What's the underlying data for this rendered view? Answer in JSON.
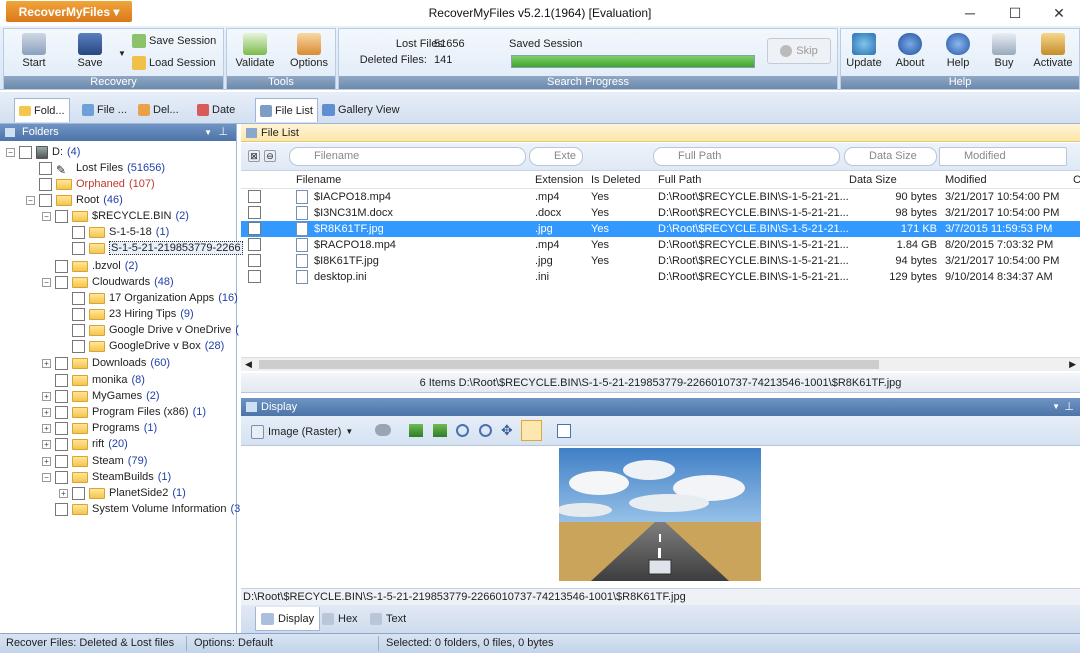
{
  "app": {
    "menu_button": "RecoverMyFiles",
    "title": "RecoverMyFiles v5.2.1(1964) [Evaluation]"
  },
  "ribbon": {
    "recovery": {
      "label": "Recovery",
      "start": "Start",
      "save": "Save",
      "save_session": "Save Session",
      "load_session": "Load Session"
    },
    "tools": {
      "label": "Tools",
      "validate": "Validate",
      "options": "Options"
    },
    "search_progress": {
      "label": "Search Progress",
      "lost_files_label": "Lost Files:",
      "lost_files_value": "51656",
      "deleted_files_label": "Deleted Files:",
      "deleted_files_value": "141",
      "status": "Saved Session",
      "progress": 1.0,
      "skip": "Skip"
    },
    "help": {
      "label": "Help",
      "update": "Update",
      "about": "About",
      "help": "Help",
      "buy": "Buy",
      "activate": "Activate"
    }
  },
  "view_tabs": {
    "folders": "Fold...",
    "file": "File ...",
    "deleted": "Del...",
    "date": "Date",
    "file_list": "File List",
    "gallery_view": "Gallery View"
  },
  "folders": {
    "header": "Folders",
    "tree": [
      {
        "name": "D:",
        "count": "(4)"
      },
      {
        "name": "Lost Files",
        "count": "(51656)"
      },
      {
        "name": "Orphaned",
        "count": "(107)"
      },
      {
        "name": "Root",
        "count": "(46)"
      },
      {
        "name": "$RECYCLE.BIN",
        "count": "(2)"
      },
      {
        "name": "S-1-5-18",
        "count": "(1)"
      },
      {
        "name": "S-1-5-21-219853779-2266",
        "count": ""
      },
      {
        "name": ".bzvol",
        "count": "(2)"
      },
      {
        "name": "Cloudwards",
        "count": "(48)"
      },
      {
        "name": "17 Organization Apps",
        "count": "(16)"
      },
      {
        "name": "23 Hiring Tips",
        "count": "(9)"
      },
      {
        "name": "Google Drive v OneDrive",
        "count": "("
      },
      {
        "name": "GoogleDrive v Box",
        "count": "(28)"
      },
      {
        "name": "Downloads",
        "count": "(60)"
      },
      {
        "name": "monika",
        "count": "(8)"
      },
      {
        "name": "MyGames",
        "count": "(2)"
      },
      {
        "name": "Program Files (x86)",
        "count": "(1)"
      },
      {
        "name": "Programs",
        "count": "(1)"
      },
      {
        "name": "rift",
        "count": "(20)"
      },
      {
        "name": "Steam",
        "count": "(79)"
      },
      {
        "name": "SteamBuilds",
        "count": "(1)"
      },
      {
        "name": "PlanetSide2",
        "count": "(1)"
      },
      {
        "name": "System Volume Information",
        "count": "(3"
      }
    ]
  },
  "file_list": {
    "header": "File List",
    "filters": {
      "filename": "Filename",
      "extension": "Exte",
      "full_path": "Full Path",
      "data_size": "Data Size",
      "modified": "Modified"
    },
    "columns": [
      "Filename",
      "Extension",
      "Is Deleted",
      "Full Path",
      "Data Size",
      "Modified",
      "C"
    ],
    "rows": [
      {
        "filename": "$IACPO18.mp4",
        "ext": ".mp4",
        "deleted": "Yes",
        "path": "D:\\Root\\$RECYCLE.BIN\\S-1-5-21-21...",
        "size": "90 bytes",
        "modified": "3/21/2017 10:54:00 PM"
      },
      {
        "filename": "$I3NC31M.docx",
        "ext": ".docx",
        "deleted": "Yes",
        "path": "D:\\Root\\$RECYCLE.BIN\\S-1-5-21-21...",
        "size": "98 bytes",
        "modified": "3/21/2017 10:54:00 PM"
      },
      {
        "filename": "$R8K61TF.jpg",
        "ext": ".jpg",
        "deleted": "Yes",
        "path": "D:\\Root\\$RECYCLE.BIN\\S-1-5-21-21...",
        "size": "171 KB",
        "modified": "3/7/2015 11:59:53 PM"
      },
      {
        "filename": "$RACPO18.mp4",
        "ext": ".mp4",
        "deleted": "Yes",
        "path": "D:\\Root\\$RECYCLE.BIN\\S-1-5-21-21...",
        "size": "1.84 GB",
        "modified": "8/20/2015 7:03:32 PM"
      },
      {
        "filename": "$I8K61TF.jpg",
        "ext": ".jpg",
        "deleted": "Yes",
        "path": "D:\\Root\\$RECYCLE.BIN\\S-1-5-21-21...",
        "size": "94 bytes",
        "modified": "3/21/2017 10:54:00 PM"
      },
      {
        "filename": "desktop.ini",
        "ext": ".ini",
        "deleted": "",
        "path": "D:\\Root\\$RECYCLE.BIN\\S-1-5-21-21...",
        "size": "129 bytes",
        "modified": "9/10/2014 8:34:37 AM"
      }
    ],
    "status": "6 Items  D:\\Root\\$RECYCLE.BIN\\S-1-5-21-219853779-2266010737-74213546-1001\\$R8K61TF.jpg"
  },
  "display": {
    "header": "Display",
    "view_mode": "Image (Raster)",
    "path": "D:\\Root\\$RECYCLE.BIN\\S-1-5-21-219853779-2266010737-74213546-1001\\$R8K61TF.jpg",
    "tabs": {
      "display": "Display",
      "hex": "Hex",
      "text": "Text"
    }
  },
  "statusbar": {
    "mode": "Recover Files: Deleted & Lost files",
    "options": "Options: Default",
    "selected": "Selected: 0 folders, 0 files, 0 bytes"
  },
  "colors": {
    "accent": "#3399ff",
    "progress": "#4cb33a",
    "app_button": "#e58b24"
  }
}
